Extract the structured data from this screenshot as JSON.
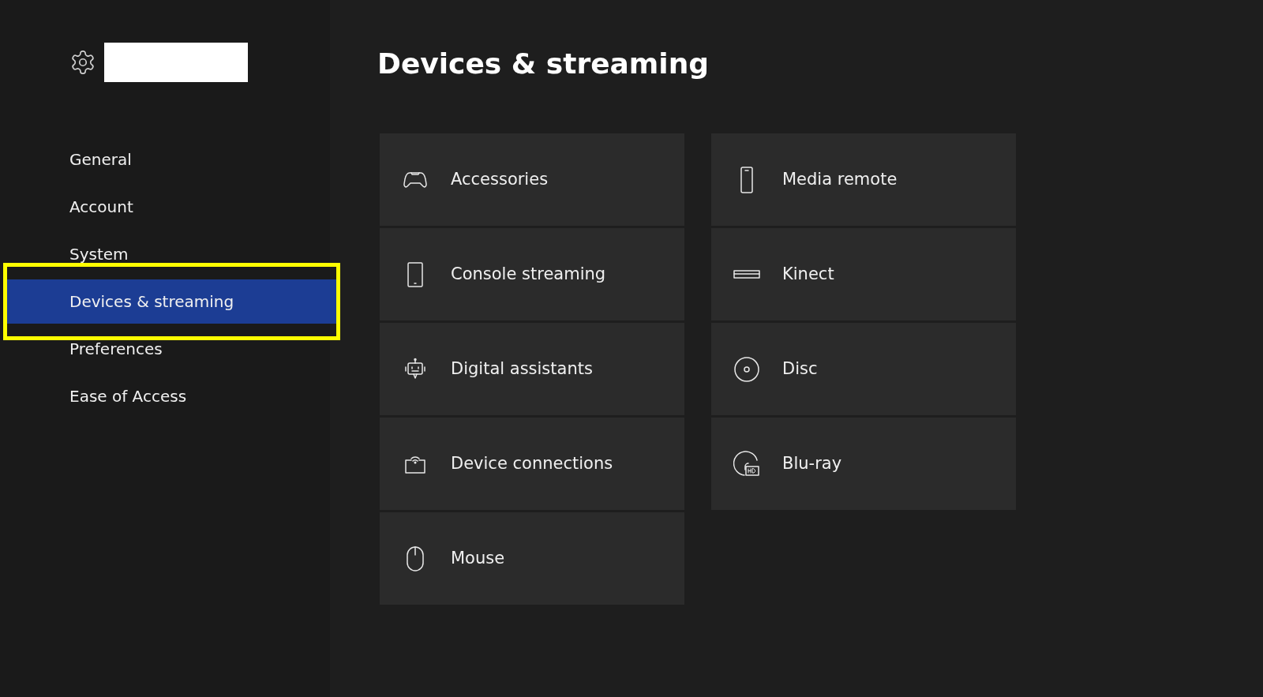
{
  "sidebar": {
    "items": [
      {
        "label": "General",
        "selected": false,
        "highlighted": false
      },
      {
        "label": "Account",
        "selected": false,
        "highlighted": false
      },
      {
        "label": "System",
        "selected": false,
        "highlighted": false
      },
      {
        "label": "Devices & streaming",
        "selected": true,
        "highlighted": true
      },
      {
        "label": "Preferences",
        "selected": false,
        "highlighted": false
      },
      {
        "label": "Ease of Access",
        "selected": false,
        "highlighted": false
      }
    ]
  },
  "page": {
    "title": "Devices & streaming"
  },
  "tile_columns": [
    {
      "tiles": [
        {
          "label": "Accessories"
        },
        {
          "label": "Console streaming"
        },
        {
          "label": "Digital assistants"
        },
        {
          "label": "Device connections"
        },
        {
          "label": "Mouse"
        }
      ]
    },
    {
      "tiles": [
        {
          "label": "Media remote"
        },
        {
          "label": "Kinect"
        },
        {
          "label": "Disc"
        },
        {
          "label": "Blu-ray"
        }
      ]
    }
  ]
}
